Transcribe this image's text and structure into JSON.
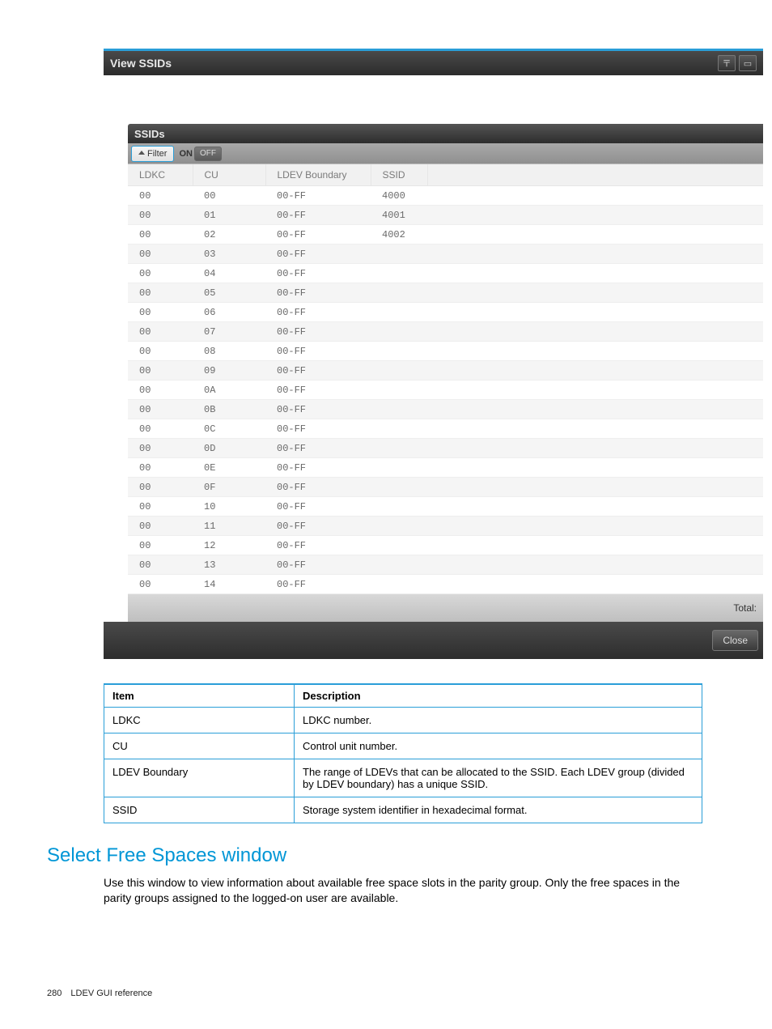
{
  "dialog": {
    "title": "View SSIDs",
    "panel_title": "SSIDs",
    "filter_label": "Filter",
    "on_label": "ON",
    "off_label": "OFF",
    "columns": {
      "ldkc": "LDKC",
      "cu": "CU",
      "boundary": "LDEV Boundary",
      "ssid": "SSID"
    },
    "rows": [
      {
        "ldkc": "00",
        "cu": "00",
        "boundary": "00-FF",
        "ssid": "4000"
      },
      {
        "ldkc": "00",
        "cu": "01",
        "boundary": "00-FF",
        "ssid": "4001"
      },
      {
        "ldkc": "00",
        "cu": "02",
        "boundary": "00-FF",
        "ssid": "4002"
      },
      {
        "ldkc": "00",
        "cu": "03",
        "boundary": "00-FF",
        "ssid": ""
      },
      {
        "ldkc": "00",
        "cu": "04",
        "boundary": "00-FF",
        "ssid": ""
      },
      {
        "ldkc": "00",
        "cu": "05",
        "boundary": "00-FF",
        "ssid": ""
      },
      {
        "ldkc": "00",
        "cu": "06",
        "boundary": "00-FF",
        "ssid": ""
      },
      {
        "ldkc": "00",
        "cu": "07",
        "boundary": "00-FF",
        "ssid": ""
      },
      {
        "ldkc": "00",
        "cu": "08",
        "boundary": "00-FF",
        "ssid": ""
      },
      {
        "ldkc": "00",
        "cu": "09",
        "boundary": "00-FF",
        "ssid": ""
      },
      {
        "ldkc": "00",
        "cu": "0A",
        "boundary": "00-FF",
        "ssid": ""
      },
      {
        "ldkc": "00",
        "cu": "0B",
        "boundary": "00-FF",
        "ssid": ""
      },
      {
        "ldkc": "00",
        "cu": "0C",
        "boundary": "00-FF",
        "ssid": ""
      },
      {
        "ldkc": "00",
        "cu": "0D",
        "boundary": "00-FF",
        "ssid": ""
      },
      {
        "ldkc": "00",
        "cu": "0E",
        "boundary": "00-FF",
        "ssid": ""
      },
      {
        "ldkc": "00",
        "cu": "0F",
        "boundary": "00-FF",
        "ssid": ""
      },
      {
        "ldkc": "00",
        "cu": "10",
        "boundary": "00-FF",
        "ssid": ""
      },
      {
        "ldkc": "00",
        "cu": "11",
        "boundary": "00-FF",
        "ssid": ""
      },
      {
        "ldkc": "00",
        "cu": "12",
        "boundary": "00-FF",
        "ssid": ""
      },
      {
        "ldkc": "00",
        "cu": "13",
        "boundary": "00-FF",
        "ssid": ""
      },
      {
        "ldkc": "00",
        "cu": "14",
        "boundary": "00-FF",
        "ssid": ""
      }
    ],
    "total_label": "Total:",
    "close_label": "Close"
  },
  "ref_table": {
    "headers": {
      "item": "Item",
      "desc": "Description"
    },
    "rows": [
      {
        "item": "LDKC",
        "desc": "LDKC number."
      },
      {
        "item": "CU",
        "desc": "Control unit number."
      },
      {
        "item": "LDEV Boundary",
        "desc": "The range of LDEVs that can be allocated to the SSID. Each LDEV group (divided by LDEV boundary) has a unique SSID."
      },
      {
        "item": "SSID",
        "desc": "Storage system identifier in hexadecimal format."
      }
    ]
  },
  "section": {
    "heading": "Select Free Spaces window",
    "body": "Use this window to view information about available free space slots in the parity group. Only the free spaces in the parity groups assigned to the logged-on user are available."
  },
  "footer": {
    "page": "280",
    "section": "LDEV GUI reference"
  }
}
